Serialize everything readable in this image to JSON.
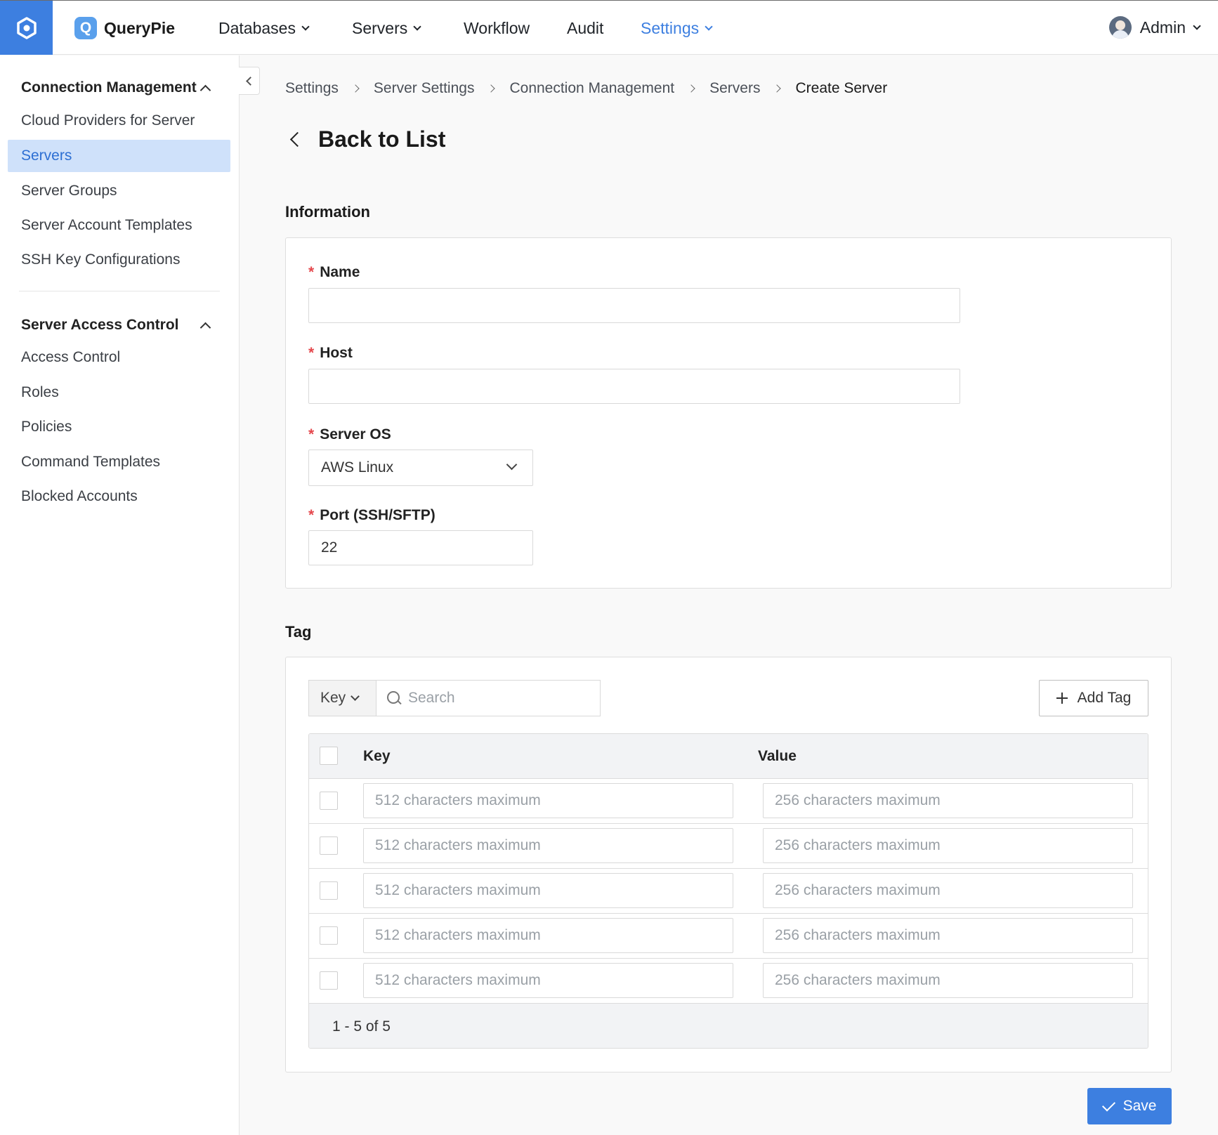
{
  "header": {
    "brand_name": "QueryPie",
    "brand_mark": "Q",
    "nav": [
      {
        "label": "Databases",
        "dropdown": true
      },
      {
        "label": "Servers",
        "dropdown": true
      },
      {
        "label": "Workflow",
        "dropdown": false
      },
      {
        "label": "Audit",
        "dropdown": false
      },
      {
        "label": "Settings",
        "dropdown": true,
        "active": true
      }
    ],
    "user_name": "Admin"
  },
  "sidebar": {
    "groups": [
      {
        "title": "Connection Management",
        "items": [
          "Cloud Providers for Server",
          "Servers",
          "Server Groups",
          "Server Account Templates",
          "SSH Key Configurations"
        ],
        "active_item": "Servers"
      },
      {
        "title": "Server Access Control",
        "items": [
          "Access Control",
          "Roles",
          "Policies",
          "Command Templates",
          "Blocked Accounts"
        ]
      }
    ]
  },
  "breadcrumb": [
    "Settings",
    "Server Settings",
    "Connection Management",
    "Servers",
    "Create Server"
  ],
  "back_label": "Back to List",
  "information": {
    "title": "Information",
    "fields": {
      "name": {
        "label": "Name",
        "value": ""
      },
      "host": {
        "label": "Host",
        "value": ""
      },
      "server_os": {
        "label": "Server OS",
        "value": "AWS Linux"
      },
      "port": {
        "label": "Port (SSH/SFTP)",
        "value": "22"
      }
    },
    "required_mark": "*"
  },
  "tag": {
    "title": "Tag",
    "filter_key_label": "Key",
    "search_placeholder": "Search",
    "add_tag_label": "Add Tag",
    "columns": {
      "key": "Key",
      "value": "Value"
    },
    "rows": [
      {
        "key_placeholder": "512 characters maximum",
        "value_placeholder": "256 characters maximum"
      },
      {
        "key_placeholder": "512 characters maximum",
        "value_placeholder": "256 characters maximum"
      },
      {
        "key_placeholder": "512 characters maximum",
        "value_placeholder": "256 characters maximum"
      },
      {
        "key_placeholder": "512 characters maximum",
        "value_placeholder": "256 characters maximum"
      },
      {
        "key_placeholder": "512 characters maximum",
        "value_placeholder": "256 characters maximum"
      }
    ],
    "pagination": "1 - 5 of 5"
  },
  "save_label": "Save",
  "colors": {
    "accent": "#3d7fe0",
    "active_bg": "#cfe1fa",
    "required": "#e5484d"
  }
}
